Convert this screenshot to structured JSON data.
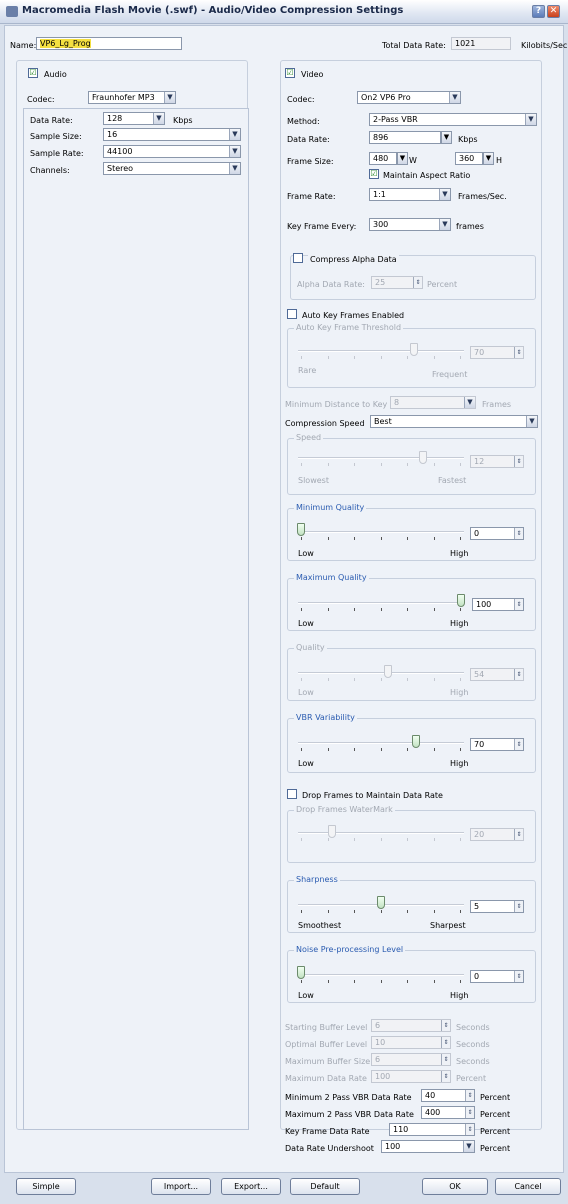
{
  "window": {
    "title": "Macromedia Flash Movie (.swf) - Audio/Video Compression Settings",
    "help": "?",
    "close": "✕"
  },
  "header": {
    "name_label": "Name:",
    "name_value": "VP6_Lg_Prog",
    "total_label": "Total Data Rate:",
    "total_value": "1021",
    "total_unit": "Kilobits/Sec"
  },
  "audio": {
    "checkbox_label": "Audio",
    "checked": "☑",
    "codec_label": "Codec:",
    "codec_value": "Fraunhofer MP3",
    "data_rate_label": "Data Rate:",
    "data_rate_value": "128",
    "data_rate_unit": "Kbps",
    "sample_size_label": "Sample Size:",
    "sample_size_value": "16",
    "sample_rate_label": "Sample Rate:",
    "sample_rate_value": "44100",
    "channels_label": "Channels:",
    "channels_value": "Stereo"
  },
  "video": {
    "checkbox_label": "Video",
    "codec_label": "Codec:",
    "codec_value": "On2 VP6 Pro",
    "method_label": "Method:",
    "method_value": "2-Pass VBR",
    "data_rate_label": "Data Rate:",
    "data_rate_value": "896",
    "data_rate_unit": "Kbps",
    "frame_size_label": "Frame Size:",
    "width_value": "480",
    "w_unit": "W",
    "height_value": "360",
    "h_unit": "H",
    "maintain_aspect_label": "Maintain Aspect Ratio",
    "frame_rate_label": "Frame Rate:",
    "frame_rate_value": "1:1",
    "frame_rate_unit": "Frames/Sec.",
    "key_frame_label": "Key Frame Every:",
    "key_frame_value": "300",
    "key_frame_unit": "frames",
    "compress_alpha_label": "Compress Alpha Data",
    "alpha_rate_label": "Alpha Data Rate:",
    "alpha_rate_value": "25",
    "alpha_rate_unit": "Percent",
    "auto_key_label": "Auto Key Frames Enabled",
    "auto_key_threshold_label": "Auto Key Frame Threshold",
    "auto_key_value": "70",
    "rare": "Rare",
    "frequent": "Frequent",
    "min_distance_label": "Minimum Distance to Key Frame",
    "min_distance_value": "8",
    "frames_unit": "Frames",
    "compression_speed_label": "Compression Speed",
    "compression_speed_value": "Best",
    "speed_label": "Speed",
    "speed_value": "12",
    "slowest": "Slowest",
    "fastest": "Fastest",
    "min_quality_label": "Minimum Quality",
    "min_quality_value": "0",
    "max_quality_label": "Maximum Quality",
    "max_quality_value": "100",
    "quality_label": "Quality",
    "quality_value": "54",
    "low": "Low",
    "high": "High",
    "vbr_label": "VBR Variability",
    "vbr_value": "70",
    "drop_frames_label": "Drop Frames to Maintain Data Rate",
    "drop_watermark_label": "Drop Frames WaterMark",
    "drop_watermark_value": "20",
    "sharpness_label": "Sharpness",
    "sharpness_value": "5",
    "smoothest": "Smoothest",
    "sharpest": "Sharpest",
    "noise_label": "Noise Pre-processing Level",
    "noise_value": "0",
    "starting_buffer_label": "Starting Buffer Level",
    "starting_buffer_value": "6",
    "optimal_buffer_label": "Optimal Buffer Level",
    "optimal_buffer_value": "10",
    "max_buffer_label": "Maximum Buffer Size",
    "max_buffer_value": "6",
    "max_data_rate_label": "Maximum Data Rate",
    "max_data_rate_value": "100",
    "seconds": "Seconds",
    "percent": "Percent",
    "min_vbr_label": "Minimum 2 Pass VBR Data Rate",
    "min_vbr_value": "40",
    "max_vbr_label": "Maximum 2 Pass VBR Data Rate",
    "max_vbr_value": "400",
    "kf_data_rate_label": "Key Frame Data Rate",
    "kf_data_rate_value": "110",
    "undershoot_label": "Data Rate Undershoot",
    "undershoot_value": "100"
  },
  "buttons": {
    "simple": "Simple",
    "import": "Import...",
    "export": "Export...",
    "default": "Default",
    "ok": "OK",
    "cancel": "Cancel"
  }
}
